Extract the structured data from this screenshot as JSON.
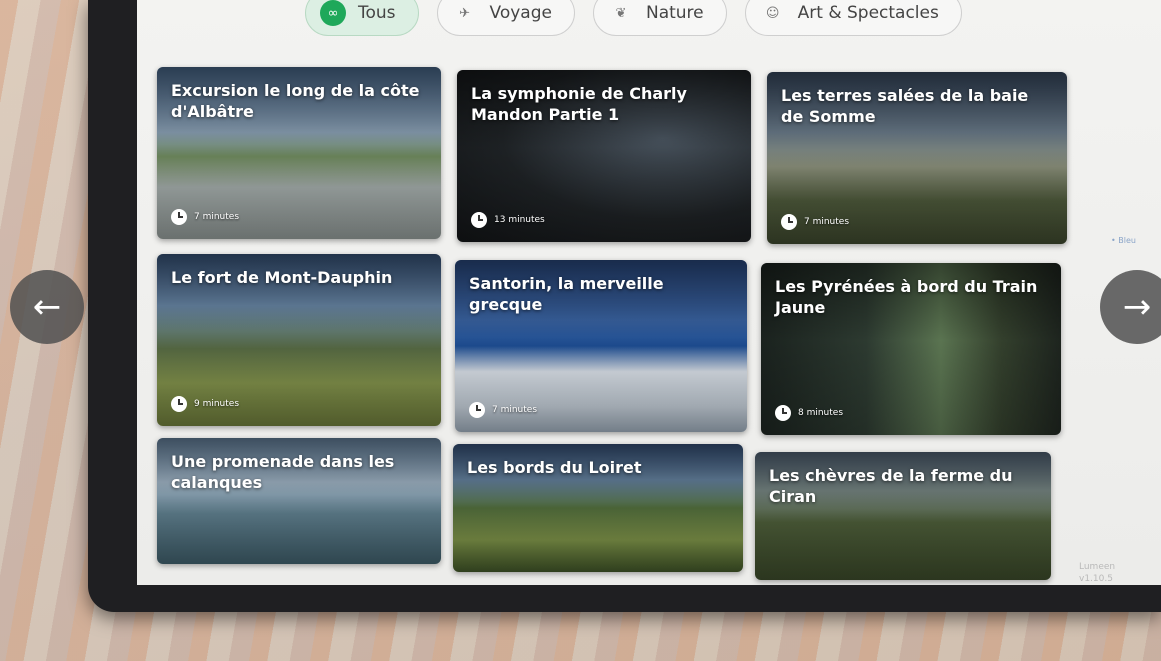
{
  "filters": [
    {
      "label": "Tous",
      "icon": "all-icon",
      "active": true
    },
    {
      "label": "Voyage",
      "icon": "plane-icon",
      "active": false
    },
    {
      "label": "Nature",
      "icon": "leaf-icon",
      "active": false
    },
    {
      "label": "Art & Spectacles",
      "icon": "mask-icon",
      "active": false
    }
  ],
  "cards": [
    {
      "title": "Excursion le long de la côte d'Albâtre",
      "duration": "7 minutes"
    },
    {
      "title": "La symphonie de Charly Mandon Partie 1",
      "duration": "13 minutes"
    },
    {
      "title": "Les terres salées de la baie de Somme",
      "duration": "7 minutes"
    },
    {
      "title": "Le fort de Mont-Dauphin",
      "duration": "9 minutes"
    },
    {
      "title": "Santorin, la merveille grecque",
      "duration": "7 minutes"
    },
    {
      "title": "Les Pyrénées à bord du Train Jaune",
      "duration": "8 minutes"
    },
    {
      "title": "Une promenade dans les calanques",
      "duration": ""
    },
    {
      "title": "Les bords du Loiret",
      "duration": ""
    },
    {
      "title": "Les chèvres de la ferme du Ciran",
      "duration": ""
    }
  ],
  "nav": {
    "prev": "←",
    "next": "→"
  },
  "side_note": "• Bleu",
  "version": {
    "brand": "Lumeen",
    "number": "v1.10.5"
  },
  "colors": {
    "accent_green": "#1fa85a",
    "card_text": "#ffffff",
    "nav_button": "#505050"
  }
}
